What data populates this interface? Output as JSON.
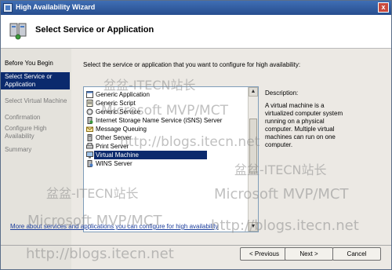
{
  "window": {
    "title": "High Availability Wizard",
    "close_glyph": "x"
  },
  "header": {
    "title": "Select Service or Application"
  },
  "steps": [
    {
      "label": "Before You Begin",
      "state": "done"
    },
    {
      "label": "Select Service or Application",
      "state": "current"
    },
    {
      "label": "Select Virtual Machine",
      "state": "pending"
    },
    {
      "label": "Confirmation",
      "state": "pending"
    },
    {
      "label": "Configure High Availability",
      "state": "pending"
    },
    {
      "label": "Summary",
      "state": "pending"
    }
  ],
  "instruction": "Select the service or application that you want to configure for high availability:",
  "list": {
    "items": [
      {
        "label": "Generic Application",
        "icon": "generic-application-icon"
      },
      {
        "label": "Generic Script",
        "icon": "generic-script-icon"
      },
      {
        "label": "Generic Service",
        "icon": "generic-service-icon"
      },
      {
        "label": "Internet Storage Name Service (iSNS) Server",
        "icon": "isns-server-icon"
      },
      {
        "label": "Message Queuing",
        "icon": "message-queuing-icon"
      },
      {
        "label": "Other Server",
        "icon": "other-server-icon"
      },
      {
        "label": "Print Server",
        "icon": "print-server-icon"
      },
      {
        "label": "Virtual Machine",
        "icon": "virtual-machine-icon",
        "selected": true
      },
      {
        "label": "WINS Server",
        "icon": "wins-server-icon"
      }
    ]
  },
  "description": {
    "label": "Description:",
    "text": "A virtual machine is a virtualized computer system running on a physical computer. Multiple virtual machines can run on one computer."
  },
  "more_link": "More about services and applications you can configure for high availability",
  "buttons": {
    "previous": "< Previous",
    "next": "Next >",
    "cancel": "Cancel"
  },
  "watermarks": {
    "site_cn": "盆盆-ITECN站长",
    "mvp": "Microsoft MVP/MCT",
    "url": "http://blogs.itecn.net"
  },
  "colors": {
    "titlebar": "#3f6eb4",
    "selection": "#0b2a6d",
    "link": "#1a3c9b"
  }
}
